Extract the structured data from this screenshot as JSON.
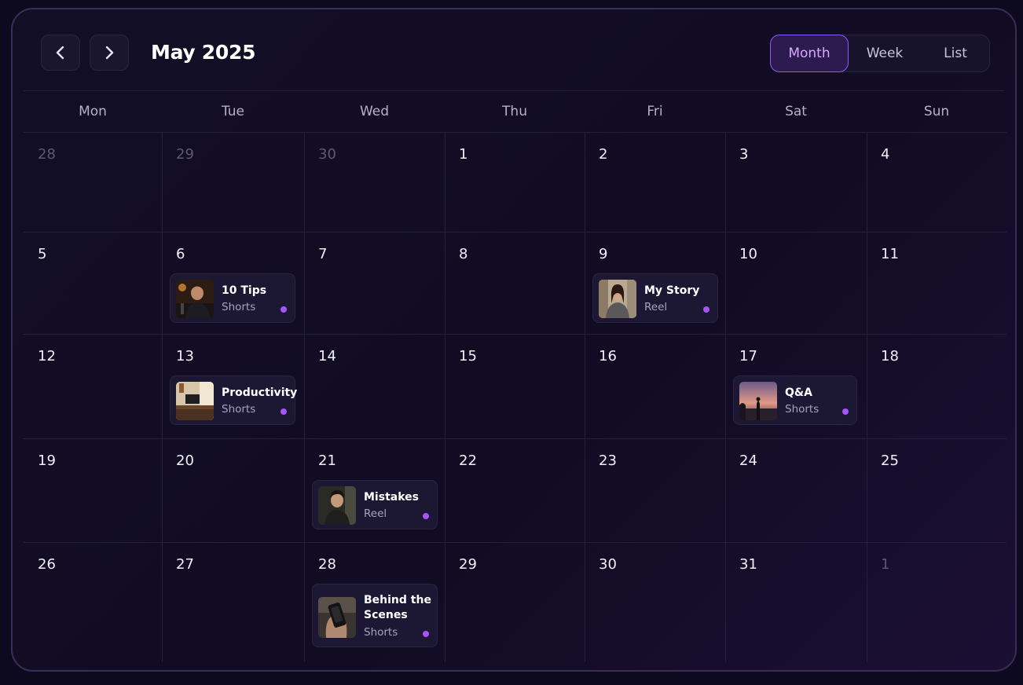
{
  "header": {
    "title": "May 2025",
    "prev_icon": "chevron-left-icon",
    "next_icon": "chevron-right-icon"
  },
  "views": {
    "month": "Month",
    "week": "Week",
    "list": "List",
    "active": "Month"
  },
  "weekdays": [
    "Mon",
    "Tue",
    "Wed",
    "Thu",
    "Fri",
    "Sat",
    "Sun"
  ],
  "weeks": [
    [
      "28",
      "29",
      "30",
      "1",
      "2",
      "3",
      "4"
    ],
    [
      "5",
      "6",
      "7",
      "8",
      "9",
      "10",
      "11"
    ],
    [
      "12",
      "13",
      "14",
      "15",
      "16",
      "17",
      "18"
    ],
    [
      "19",
      "20",
      "21",
      "22",
      "23",
      "24",
      "25"
    ],
    [
      "26",
      "27",
      "28",
      "29",
      "30",
      "31",
      "1"
    ]
  ],
  "events": [
    {
      "title": "10 Tips",
      "type": "Shorts"
    },
    {
      "title": "My Story",
      "type": "Reel"
    },
    {
      "title": "Productivity",
      "type": "Shorts"
    },
    {
      "title": "Q&A",
      "type": "Shorts"
    },
    {
      "title": "Mistakes",
      "type": "Reel"
    },
    {
      "title": "Behind the Scenes",
      "type": "Shorts"
    }
  ],
  "colors": {
    "accent": "#a855f7",
    "active_view_text": "#d8a8ff",
    "background": "#110c24"
  }
}
